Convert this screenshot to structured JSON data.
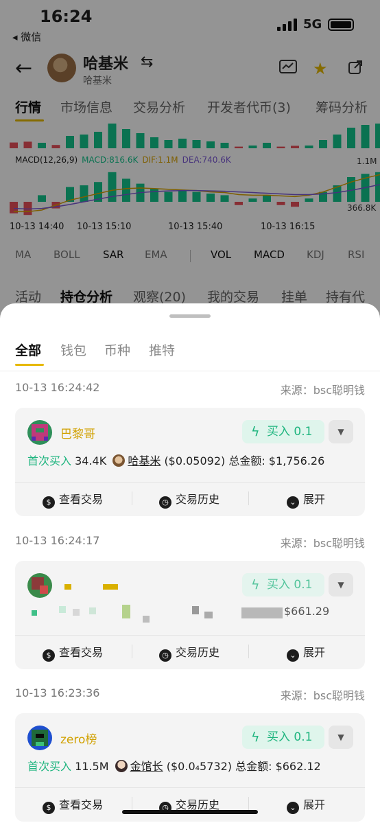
{
  "status_bar": {
    "time": "16:24",
    "back_app": "◂ 微信",
    "network": "5G"
  },
  "header": {
    "token_name": "哈基米",
    "token_symbol": "哈基米"
  },
  "main_tabs": [
    "行情",
    "市场信息",
    "交易分析",
    "开发者代币(3)",
    "筹码分析"
  ],
  "chart": {
    "macd_label": "MACD(12,26,9)",
    "macd_value": "MACD:816.6K",
    "dif_value": "DIF:1.1M",
    "dea_value": "DEA:740.6K",
    "axis_top": "1.1M",
    "axis_bottom": "366.8K",
    "time_ticks": [
      "10-13 14:40",
      "10-13 15:10",
      "10-13 15:40",
      "10-13 16:15"
    ]
  },
  "chart_data": {
    "type": "bar",
    "title": "MACD(12,26,9)",
    "x_ticks": [
      "10-13 14:40",
      "10-13 15:10",
      "10-13 15:40",
      "10-13 16:15"
    ],
    "y_ticks": [
      "1.1M",
      "366.8K"
    ],
    "series": [
      {
        "name": "MACD",
        "values": [
          -0.35,
          -0.4,
          0.2,
          -0.2,
          0.45,
          0.5,
          0.6,
          0.9,
          0.7,
          0.55,
          0.4,
          0.3,
          0.35,
          0.3,
          0.25,
          0.2,
          -0.1,
          0.1,
          0.2,
          -0.1,
          -0.15,
          0.1,
          0.3,
          0.5,
          0.75,
          0.85,
          0.9,
          0.95
        ]
      },
      {
        "name": "DIF",
        "values": [
          -0.3,
          -0.3,
          -0.25,
          -0.1,
          0.05,
          0.15,
          0.25,
          0.35,
          0.4,
          0.42,
          0.4,
          0.38,
          0.36,
          0.34,
          0.3,
          0.28,
          0.22,
          0.2,
          0.2,
          0.18,
          0.16,
          0.2,
          0.3,
          0.45,
          0.6,
          0.72,
          0.82,
          0.9
        ]
      },
      {
        "name": "DEA",
        "values": [
          -0.2,
          -0.22,
          -0.2,
          -0.15,
          -0.08,
          0.0,
          0.08,
          0.16,
          0.22,
          0.28,
          0.31,
          0.33,
          0.34,
          0.34,
          0.33,
          0.32,
          0.3,
          0.28,
          0.26,
          0.24,
          0.22,
          0.22,
          0.24,
          0.28,
          0.35,
          0.43,
          0.52,
          0.6
        ]
      }
    ],
    "colors": {
      "up": "#12c48c",
      "down": "#e8505b",
      "dif": "#d9a300",
      "dea": "#7b58d6"
    }
  },
  "indicators": [
    "MA",
    "BOLL",
    "SAR",
    "EMA",
    "VOL",
    "MACD",
    "KDJ",
    "RSI"
  ],
  "sub_tabs": [
    "活动",
    "持仓分析",
    "观察(20)",
    "我的交易",
    "挂单",
    "持有代"
  ],
  "sheet": {
    "tabs": [
      "全部",
      "钱包",
      "币种",
      "推特"
    ],
    "actions": {
      "view_trade": "查看交易",
      "trade_history": "交易历史",
      "expand": "展开"
    },
    "entries": [
      {
        "time": "10-13 16:24:42",
        "source": "来源：bsc聪明钱",
        "wallet": "巴黎哥",
        "badge": "买入 0.1",
        "first_buy": "首次买入",
        "amount": "34.4K",
        "coin": "哈基米",
        "price": "($0.05092)",
        "total": "总金额: $1,756.26"
      },
      {
        "time": "10-13 16:24:17",
        "source": "来源：bsc聪明钱",
        "wallet": "",
        "badge": "买入 0.1",
        "total_partial": "$661.29"
      },
      {
        "time": "10-13 16:23:36",
        "source": "来源：bsc聪明钱",
        "wallet": "zero榜",
        "badge": "买入 0.1",
        "first_buy": "首次买入",
        "amount": "11.5M",
        "coin": "金馆长",
        "price": "($0.0₄5732)",
        "total": "总金额: $662.12"
      }
    ]
  }
}
